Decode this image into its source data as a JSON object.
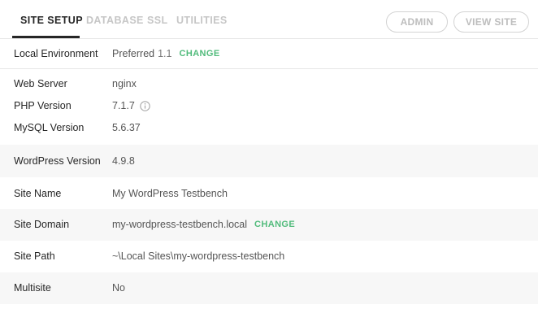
{
  "tabs": [
    {
      "label": "SITE SETUP",
      "active": true
    },
    {
      "label": "DATABASE",
      "active": false
    },
    {
      "label": "SSL",
      "active": false
    },
    {
      "label": "UTILITIES",
      "active": false
    }
  ],
  "actions": {
    "admin_label": "ADMIN",
    "view_site_label": "VIEW SITE"
  },
  "rows": {
    "local_environment": {
      "label": "Local Environment",
      "value": "Preferred",
      "version": "1.1",
      "action": "CHANGE"
    },
    "web_server": {
      "label": "Web Server",
      "value": "nginx"
    },
    "php_version": {
      "label": "PHP Version",
      "value": "7.1.7",
      "icon": "info-icon"
    },
    "mysql_version": {
      "label": "MySQL Version",
      "value": "5.6.37"
    },
    "wordpress_version": {
      "label": "WordPress Version",
      "value": "4.9.8"
    },
    "site_name": {
      "label": "Site Name",
      "value": "My WordPress Testbench"
    },
    "site_domain": {
      "label": "Site Domain",
      "value": "my-wordpress-testbench.local",
      "action": "CHANGE"
    },
    "site_path": {
      "label": "Site Path",
      "value": "~\\Local Sites\\my-wordpress-testbench"
    },
    "multisite": {
      "label": "Multisite",
      "value": "No"
    }
  },
  "colors": {
    "accent_green": "#51bb7b",
    "active_tab": "#262626",
    "inactive_tab": "#c6c6c6",
    "shaded_row": "#f7f7f7"
  }
}
